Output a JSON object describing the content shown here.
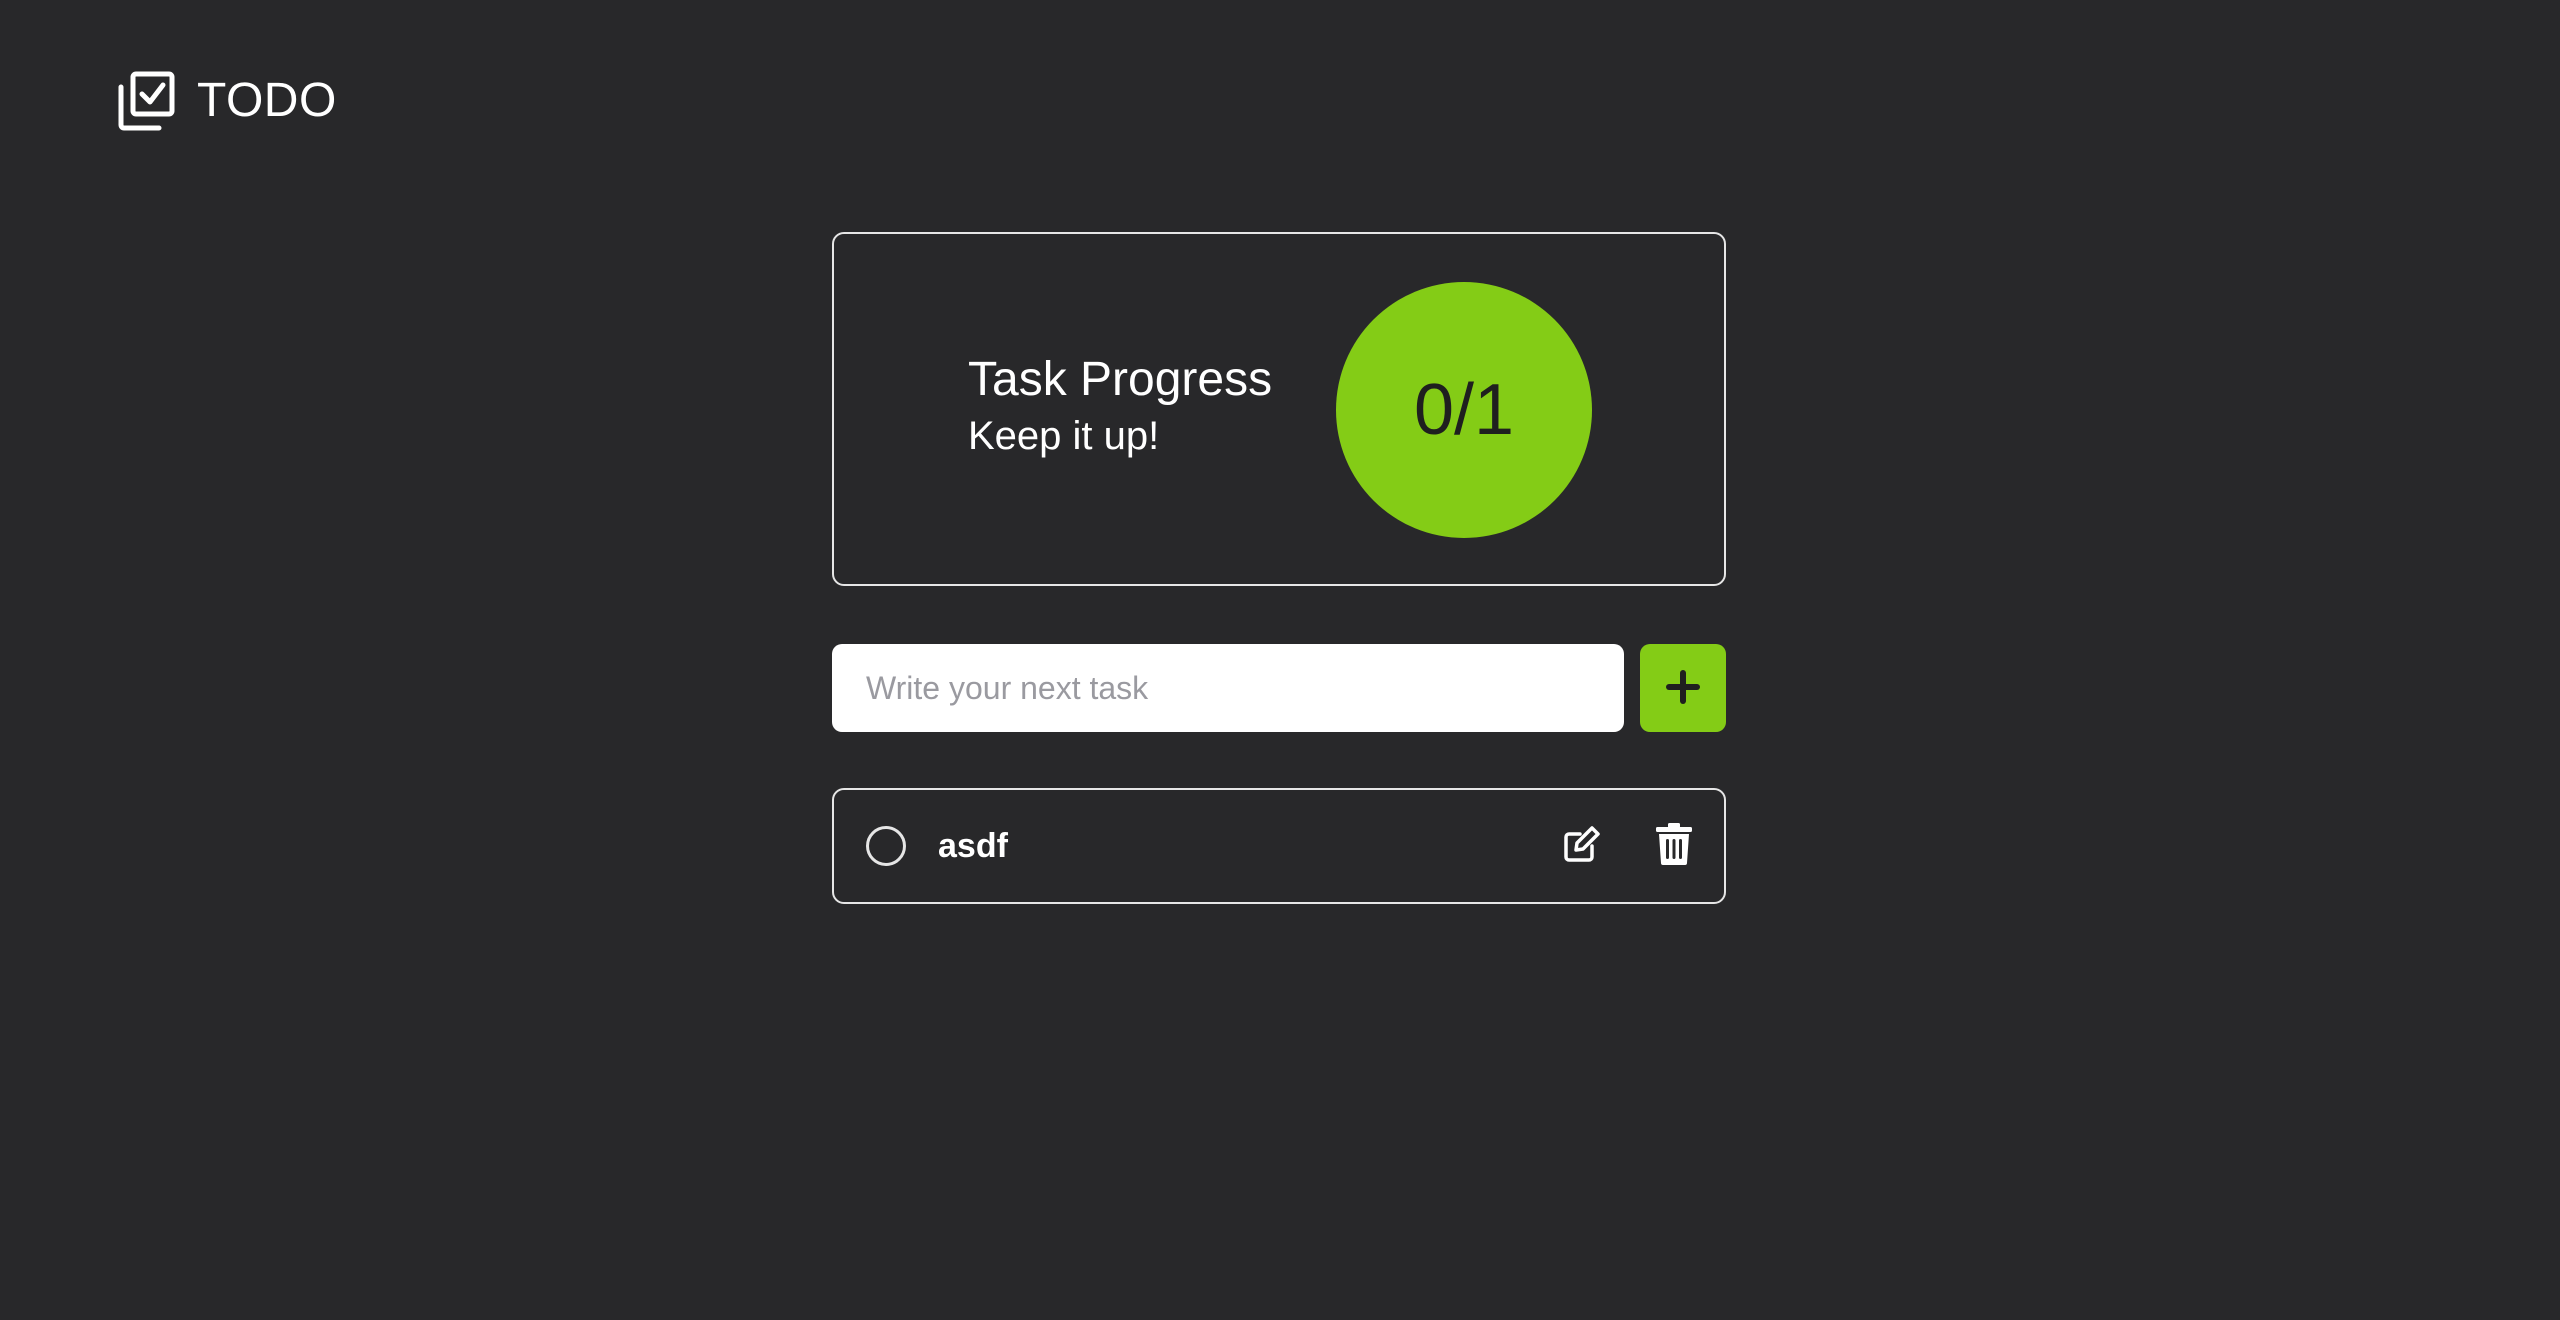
{
  "app": {
    "title": "TODO",
    "logo_icon": "checklist-icon"
  },
  "progress": {
    "title": "Task Progress",
    "subtitle": "Keep it up!",
    "display": "0/1",
    "completed": 0,
    "total": 1,
    "circle_color": "#84cc16"
  },
  "task_form": {
    "placeholder": "Write your next task",
    "value": "",
    "add_icon": "plus-icon"
  },
  "tasks": [
    {
      "label": "asdf",
      "done": false,
      "edit_icon": "edit-icon",
      "delete_icon": "trash-icon"
    }
  ],
  "colors": {
    "background": "#28282a",
    "accent": "#84cc16",
    "border": "#e6e6e6"
  }
}
